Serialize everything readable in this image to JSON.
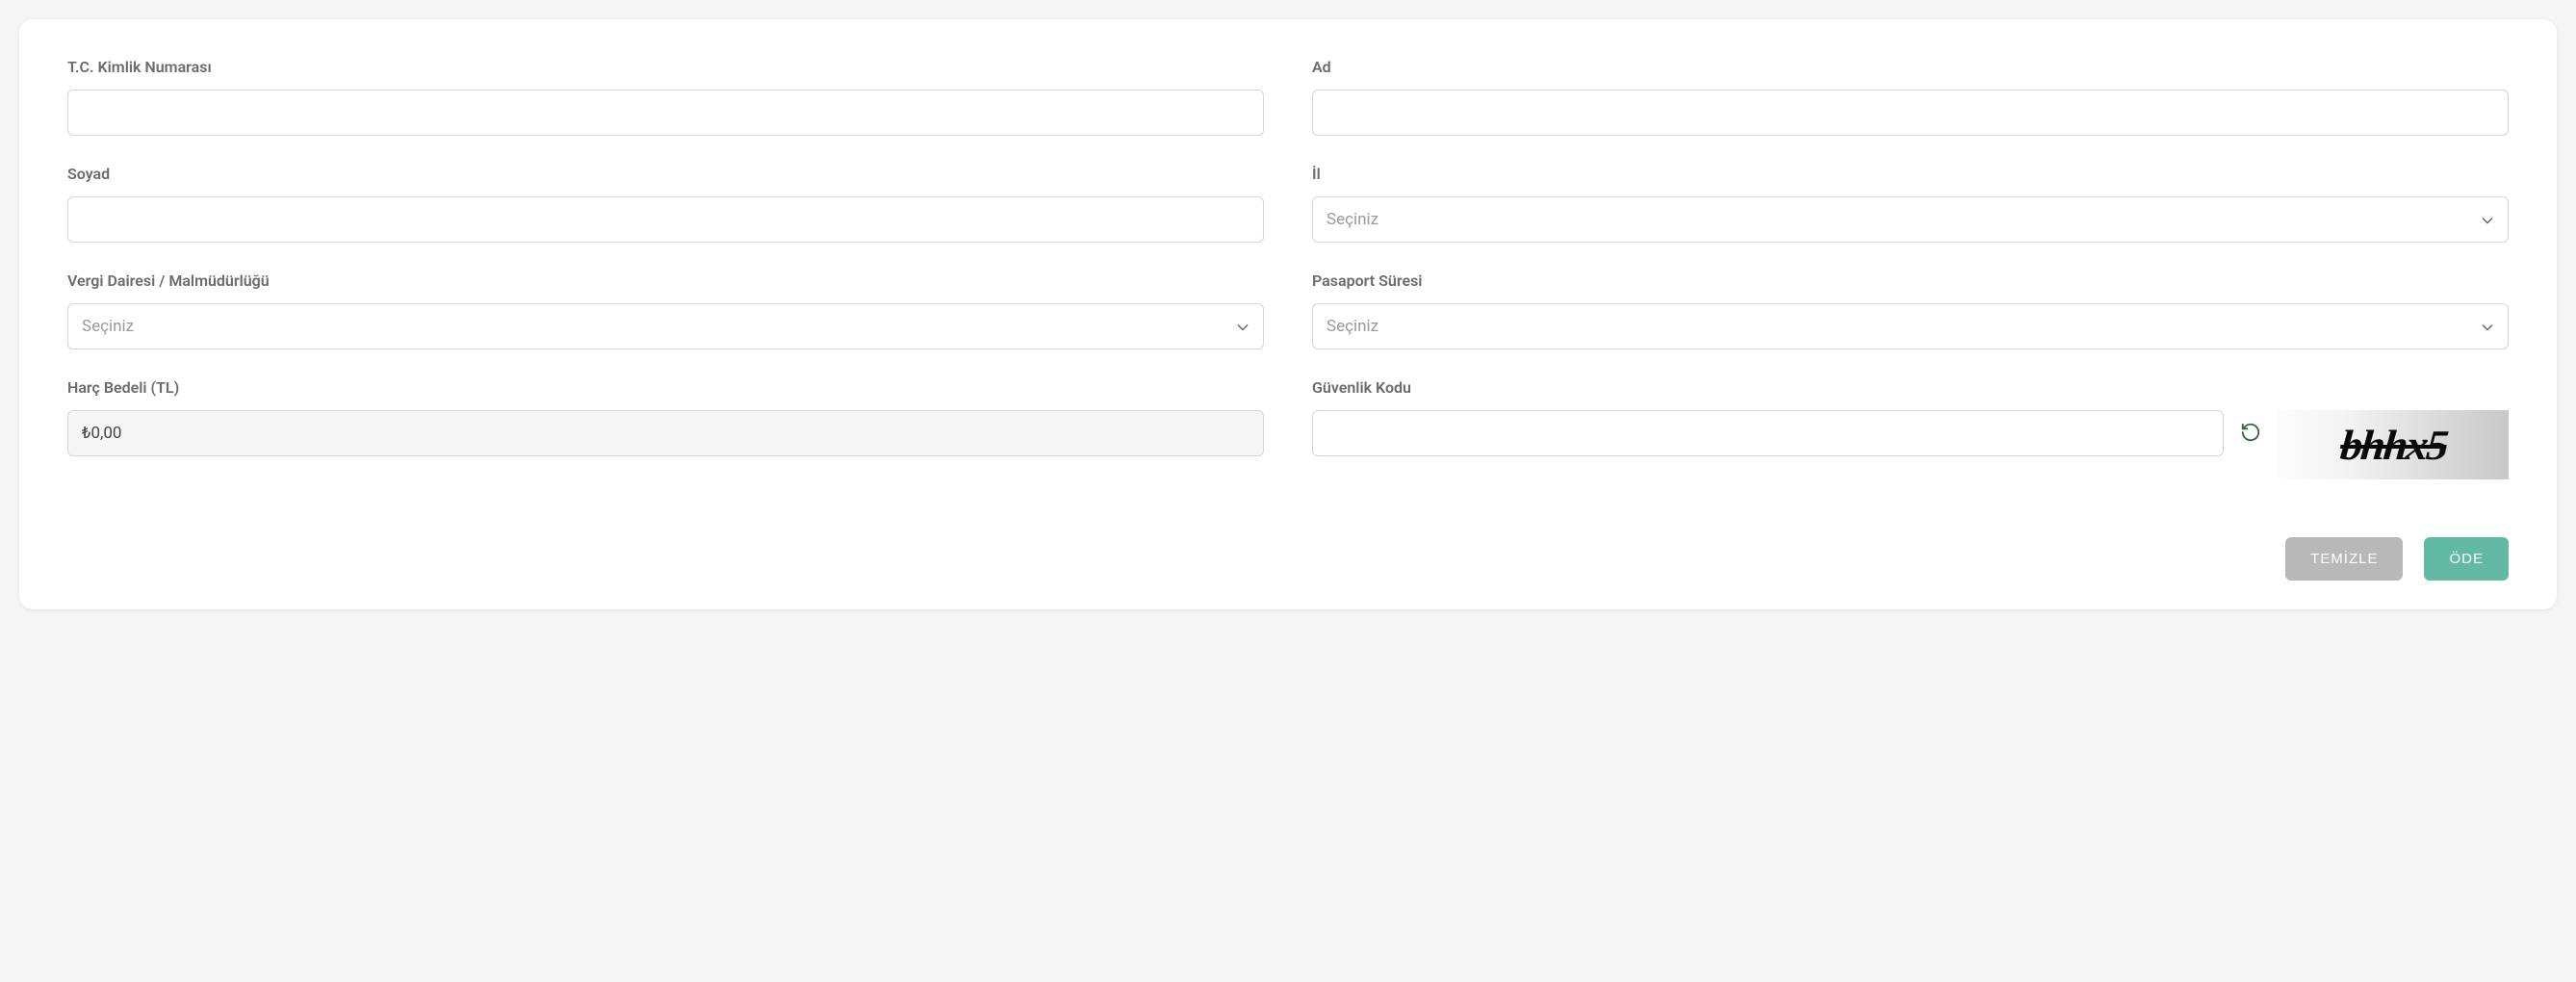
{
  "form": {
    "tc_kimlik": {
      "label": "T.C. Kimlik Numarası",
      "value": ""
    },
    "ad": {
      "label": "Ad",
      "value": ""
    },
    "soyad": {
      "label": "Soyad",
      "value": ""
    },
    "il": {
      "label": "İl",
      "placeholder": "Seçiniz"
    },
    "vergi_dairesi": {
      "label": "Vergi Dairesi / Malmüdürlüğü",
      "placeholder": "Seçiniz"
    },
    "pasaport_suresi": {
      "label": "Pasaport Süresi",
      "placeholder": "Seçiniz"
    },
    "harc_bedeli": {
      "label": "Harç Bedeli (TL)",
      "value": "₺0,00"
    },
    "guvenlik_kodu": {
      "label": "Güvenlik Kodu",
      "value": ""
    },
    "captcha_text": "bhhx5"
  },
  "buttons": {
    "clear": "TEMİZLE",
    "pay": "ÖDE"
  }
}
